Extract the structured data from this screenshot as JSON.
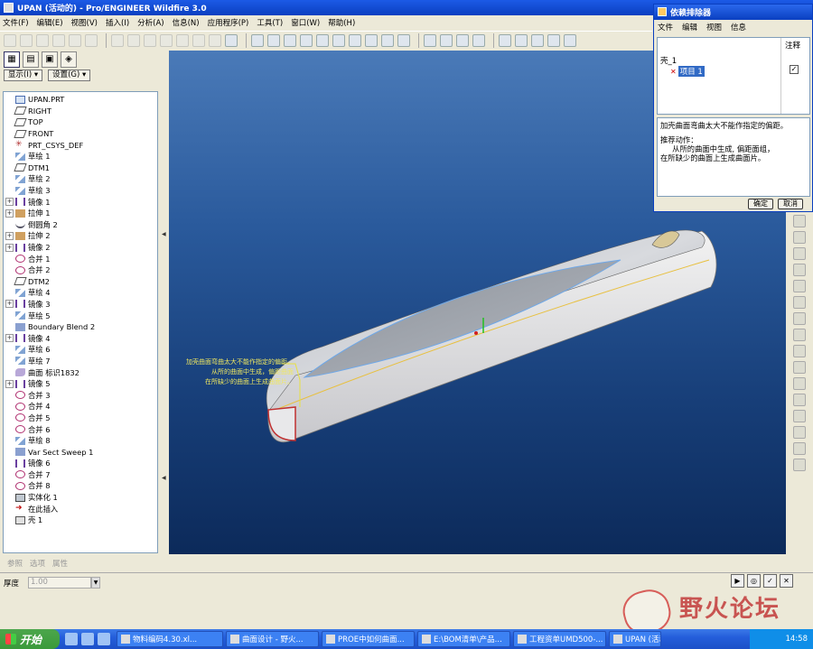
{
  "window": {
    "title": "UPAN (活动的) - Pro/ENGINEER Wildfire 3.0"
  },
  "menubar": [
    "文件(F)",
    "编辑(E)",
    "视图(V)",
    "插入(I)",
    "分析(A)",
    "信息(N)",
    "应用程序(P)",
    "工具(T)",
    "窗口(W)",
    "帮助(H)"
  ],
  "navigator": {
    "show_label": "显示(I) ▾",
    "settings_label": "设置(G) ▾"
  },
  "tree": [
    {
      "icon": "part",
      "label": "UPAN.PRT",
      "expandable": false
    },
    {
      "icon": "plane",
      "label": "RIGHT",
      "expandable": false
    },
    {
      "icon": "plane",
      "label": "TOP",
      "expandable": false
    },
    {
      "icon": "plane",
      "label": "FRONT",
      "expandable": false
    },
    {
      "icon": "csys",
      "label": "PRT_CSYS_DEF",
      "expandable": false
    },
    {
      "icon": "sketch",
      "label": "草绘 1",
      "expandable": false
    },
    {
      "icon": "plane",
      "label": "DTM1",
      "expandable": false
    },
    {
      "icon": "sketch",
      "label": "草绘 2",
      "expandable": false
    },
    {
      "icon": "sketch",
      "label": "草绘 3",
      "expandable": false
    },
    {
      "icon": "mirror",
      "label": "镜像 1",
      "expandable": true
    },
    {
      "icon": "extrude",
      "label": "拉伸 1",
      "expandable": true
    },
    {
      "icon": "round",
      "label": "倒圆角 2",
      "expandable": false
    },
    {
      "icon": "extrude",
      "label": "拉伸 2",
      "expandable": true
    },
    {
      "icon": "mirror",
      "label": "镜像 2",
      "expandable": true
    },
    {
      "icon": "merge",
      "label": "合并 1",
      "expandable": false
    },
    {
      "icon": "merge",
      "label": "合并 2",
      "expandable": false
    },
    {
      "icon": "plane",
      "label": "DTM2",
      "expandable": false
    },
    {
      "icon": "sketch",
      "label": "草绘 4",
      "expandable": false
    },
    {
      "icon": "mirror",
      "label": "镜像 3",
      "expandable": true
    },
    {
      "icon": "sketch",
      "label": "草绘 5",
      "expandable": false
    },
    {
      "icon": "blend",
      "label": "Boundary Blend 2",
      "expandable": false
    },
    {
      "icon": "mirror",
      "label": "镜像 4",
      "expandable": true
    },
    {
      "icon": "sketch",
      "label": "草绘 6",
      "expandable": false
    },
    {
      "icon": "sketch",
      "label": "草绘 7",
      "expandable": false
    },
    {
      "icon": "surface",
      "label": "曲面 标识1832",
      "expandable": false
    },
    {
      "icon": "mirror",
      "label": "镜像 5",
      "expandable": true
    },
    {
      "icon": "merge",
      "label": "合并 3",
      "expandable": false
    },
    {
      "icon": "merge",
      "label": "合并 4",
      "expandable": false
    },
    {
      "icon": "merge",
      "label": "合并 5",
      "expandable": false
    },
    {
      "icon": "merge",
      "label": "合并 6",
      "expandable": false
    },
    {
      "icon": "sketch",
      "label": "草绘 8",
      "expandable": false
    },
    {
      "icon": "blend",
      "label": "Var Sect Sweep 1",
      "expandable": false
    },
    {
      "icon": "mirror",
      "label": "镜像 6",
      "expandable": false
    },
    {
      "icon": "merge",
      "label": "合并 7",
      "expandable": false
    },
    {
      "icon": "merge",
      "label": "合并 8",
      "expandable": false
    },
    {
      "icon": "solid",
      "label": "实体化 1",
      "expandable": false
    },
    {
      "icon": "insert",
      "label": "在此插入",
      "expandable": false
    },
    {
      "icon": "shell",
      "label": "壳 1",
      "expandable": false
    }
  ],
  "lower_tabs": [
    "参照",
    "选项",
    "属性"
  ],
  "dashboard": {
    "thickness_label": "厚度",
    "thickness_value": "1.00"
  },
  "viewport": {
    "annotation_lines": [
      "加壳曲面弯曲太大不能作指定的偏距。",
      "从所的曲面中生成，偏距曲面",
      "在所缺少的曲面上生成曲面片。"
    ]
  },
  "dialog": {
    "title": "依赖排除器",
    "menu": [
      "文件",
      "编辑",
      "视图",
      "信息"
    ],
    "notes_header": "注释",
    "items": [
      {
        "label": "壳_1"
      },
      {
        "label": "项目 1",
        "selected": true
      }
    ],
    "message_lines": [
      "加壳曲面弯曲太大不能作指定的偏距。",
      "",
      "推荐动作：",
      "     从所的曲面中生成, 偏距面组，",
      "在所缺少的曲面上生成曲面片。"
    ],
    "ok_label": "确定",
    "cancel_label": "取消"
  },
  "watermark": "野火论坛",
  "taskbar": {
    "start_label": "开始",
    "tasks": [
      "物料编码4.30.xl...",
      "曲面设计 - 野火...",
      "PROE中如何曲面...",
      "E:\\BOM清单\\产品...",
      "工程资单UMD500-...",
      "UPAN (活动的) - ..."
    ],
    "clock": "14:58"
  }
}
